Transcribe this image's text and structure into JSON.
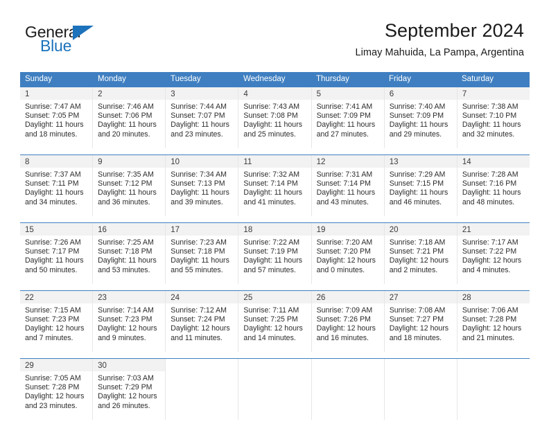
{
  "brand": {
    "word_one": "General",
    "word_two": "Blue",
    "triangle_color": "#1c72bb"
  },
  "header": {
    "title": "September 2024",
    "subtitle": "Limay Mahuida, La Pampa, Argentina"
  },
  "theme": {
    "header_blue": "#3f7fc1",
    "daynum_band": "#f2f2f2",
    "text": "#2b2b2b"
  },
  "weekdays": [
    "Sunday",
    "Monday",
    "Tuesday",
    "Wednesday",
    "Thursday",
    "Friday",
    "Saturday"
  ],
  "weeks": [
    [
      {
        "day": "1",
        "sunrise": "Sunrise: 7:47 AM",
        "sunset": "Sunset: 7:05 PM",
        "daylight1": "Daylight: 11 hours",
        "daylight2": "and 18 minutes."
      },
      {
        "day": "2",
        "sunrise": "Sunrise: 7:46 AM",
        "sunset": "Sunset: 7:06 PM",
        "daylight1": "Daylight: 11 hours",
        "daylight2": "and 20 minutes."
      },
      {
        "day": "3",
        "sunrise": "Sunrise: 7:44 AM",
        "sunset": "Sunset: 7:07 PM",
        "daylight1": "Daylight: 11 hours",
        "daylight2": "and 23 minutes."
      },
      {
        "day": "4",
        "sunrise": "Sunrise: 7:43 AM",
        "sunset": "Sunset: 7:08 PM",
        "daylight1": "Daylight: 11 hours",
        "daylight2": "and 25 minutes."
      },
      {
        "day": "5",
        "sunrise": "Sunrise: 7:41 AM",
        "sunset": "Sunset: 7:09 PM",
        "daylight1": "Daylight: 11 hours",
        "daylight2": "and 27 minutes."
      },
      {
        "day": "6",
        "sunrise": "Sunrise: 7:40 AM",
        "sunset": "Sunset: 7:09 PM",
        "daylight1": "Daylight: 11 hours",
        "daylight2": "and 29 minutes."
      },
      {
        "day": "7",
        "sunrise": "Sunrise: 7:38 AM",
        "sunset": "Sunset: 7:10 PM",
        "daylight1": "Daylight: 11 hours",
        "daylight2": "and 32 minutes."
      }
    ],
    [
      {
        "day": "8",
        "sunrise": "Sunrise: 7:37 AM",
        "sunset": "Sunset: 7:11 PM",
        "daylight1": "Daylight: 11 hours",
        "daylight2": "and 34 minutes."
      },
      {
        "day": "9",
        "sunrise": "Sunrise: 7:35 AM",
        "sunset": "Sunset: 7:12 PM",
        "daylight1": "Daylight: 11 hours",
        "daylight2": "and 36 minutes."
      },
      {
        "day": "10",
        "sunrise": "Sunrise: 7:34 AM",
        "sunset": "Sunset: 7:13 PM",
        "daylight1": "Daylight: 11 hours",
        "daylight2": "and 39 minutes."
      },
      {
        "day": "11",
        "sunrise": "Sunrise: 7:32 AM",
        "sunset": "Sunset: 7:14 PM",
        "daylight1": "Daylight: 11 hours",
        "daylight2": "and 41 minutes."
      },
      {
        "day": "12",
        "sunrise": "Sunrise: 7:31 AM",
        "sunset": "Sunset: 7:14 PM",
        "daylight1": "Daylight: 11 hours",
        "daylight2": "and 43 minutes."
      },
      {
        "day": "13",
        "sunrise": "Sunrise: 7:29 AM",
        "sunset": "Sunset: 7:15 PM",
        "daylight1": "Daylight: 11 hours",
        "daylight2": "and 46 minutes."
      },
      {
        "day": "14",
        "sunrise": "Sunrise: 7:28 AM",
        "sunset": "Sunset: 7:16 PM",
        "daylight1": "Daylight: 11 hours",
        "daylight2": "and 48 minutes."
      }
    ],
    [
      {
        "day": "15",
        "sunrise": "Sunrise: 7:26 AM",
        "sunset": "Sunset: 7:17 PM",
        "daylight1": "Daylight: 11 hours",
        "daylight2": "and 50 minutes."
      },
      {
        "day": "16",
        "sunrise": "Sunrise: 7:25 AM",
        "sunset": "Sunset: 7:18 PM",
        "daylight1": "Daylight: 11 hours",
        "daylight2": "and 53 minutes."
      },
      {
        "day": "17",
        "sunrise": "Sunrise: 7:23 AM",
        "sunset": "Sunset: 7:18 PM",
        "daylight1": "Daylight: 11 hours",
        "daylight2": "and 55 minutes."
      },
      {
        "day": "18",
        "sunrise": "Sunrise: 7:22 AM",
        "sunset": "Sunset: 7:19 PM",
        "daylight1": "Daylight: 11 hours",
        "daylight2": "and 57 minutes."
      },
      {
        "day": "19",
        "sunrise": "Sunrise: 7:20 AM",
        "sunset": "Sunset: 7:20 PM",
        "daylight1": "Daylight: 12 hours",
        "daylight2": "and 0 minutes."
      },
      {
        "day": "20",
        "sunrise": "Sunrise: 7:18 AM",
        "sunset": "Sunset: 7:21 PM",
        "daylight1": "Daylight: 12 hours",
        "daylight2": "and 2 minutes."
      },
      {
        "day": "21",
        "sunrise": "Sunrise: 7:17 AM",
        "sunset": "Sunset: 7:22 PM",
        "daylight1": "Daylight: 12 hours",
        "daylight2": "and 4 minutes."
      }
    ],
    [
      {
        "day": "22",
        "sunrise": "Sunrise: 7:15 AM",
        "sunset": "Sunset: 7:23 PM",
        "daylight1": "Daylight: 12 hours",
        "daylight2": "and 7 minutes."
      },
      {
        "day": "23",
        "sunrise": "Sunrise: 7:14 AM",
        "sunset": "Sunset: 7:23 PM",
        "daylight1": "Daylight: 12 hours",
        "daylight2": "and 9 minutes."
      },
      {
        "day": "24",
        "sunrise": "Sunrise: 7:12 AM",
        "sunset": "Sunset: 7:24 PM",
        "daylight1": "Daylight: 12 hours",
        "daylight2": "and 11 minutes."
      },
      {
        "day": "25",
        "sunrise": "Sunrise: 7:11 AM",
        "sunset": "Sunset: 7:25 PM",
        "daylight1": "Daylight: 12 hours",
        "daylight2": "and 14 minutes."
      },
      {
        "day": "26",
        "sunrise": "Sunrise: 7:09 AM",
        "sunset": "Sunset: 7:26 PM",
        "daylight1": "Daylight: 12 hours",
        "daylight2": "and 16 minutes."
      },
      {
        "day": "27",
        "sunrise": "Sunrise: 7:08 AM",
        "sunset": "Sunset: 7:27 PM",
        "daylight1": "Daylight: 12 hours",
        "daylight2": "and 18 minutes."
      },
      {
        "day": "28",
        "sunrise": "Sunrise: 7:06 AM",
        "sunset": "Sunset: 7:28 PM",
        "daylight1": "Daylight: 12 hours",
        "daylight2": "and 21 minutes."
      }
    ],
    [
      {
        "day": "29",
        "sunrise": "Sunrise: 7:05 AM",
        "sunset": "Sunset: 7:28 PM",
        "daylight1": "Daylight: 12 hours",
        "daylight2": "and 23 minutes."
      },
      {
        "day": "30",
        "sunrise": "Sunrise: 7:03 AM",
        "sunset": "Sunset: 7:29 PM",
        "daylight1": "Daylight: 12 hours",
        "daylight2": "and 26 minutes."
      },
      {
        "day": "",
        "sunrise": "",
        "sunset": "",
        "daylight1": "",
        "daylight2": ""
      },
      {
        "day": "",
        "sunrise": "",
        "sunset": "",
        "daylight1": "",
        "daylight2": ""
      },
      {
        "day": "",
        "sunrise": "",
        "sunset": "",
        "daylight1": "",
        "daylight2": ""
      },
      {
        "day": "",
        "sunrise": "",
        "sunset": "",
        "daylight1": "",
        "daylight2": ""
      },
      {
        "day": "",
        "sunrise": "",
        "sunset": "",
        "daylight1": "",
        "daylight2": ""
      }
    ]
  ]
}
